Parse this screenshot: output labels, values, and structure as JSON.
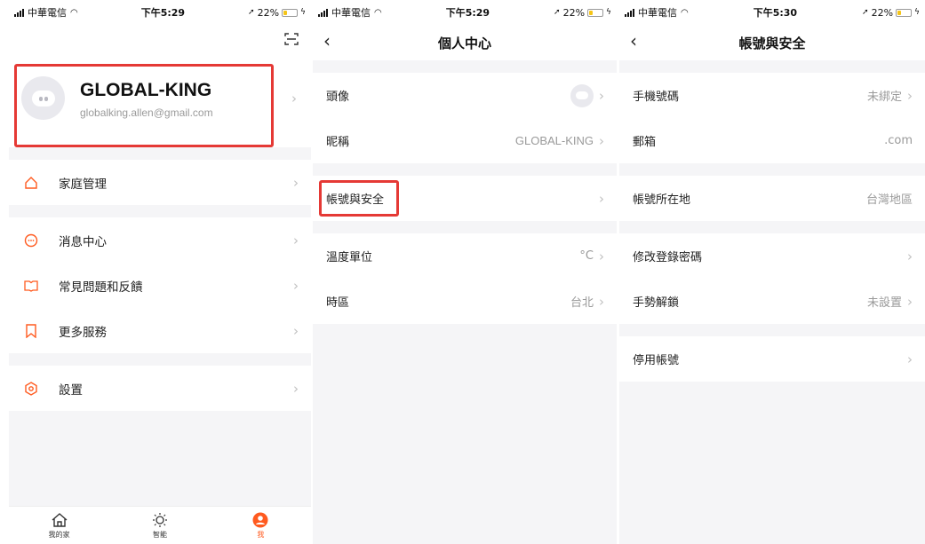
{
  "status": {
    "s1": {
      "carrier": "中華電信",
      "time": "下午5:29",
      "battery": "22%"
    },
    "s2": {
      "carrier": "中華電信",
      "time": "下午5:29",
      "battery": "22%"
    },
    "s3": {
      "carrier": "中華電信",
      "time": "下午5:30",
      "battery": "22%"
    }
  },
  "colors": {
    "accent": "#ff5a1f",
    "highlight_box": "#e53935"
  },
  "screen1": {
    "profile": {
      "name": "GLOBAL-KING",
      "email": "globalking.allen@gmail.com"
    },
    "menu": [
      {
        "label": "家庭管理",
        "icon": "home-icon"
      },
      {
        "label": "消息中心",
        "icon": "message-icon"
      },
      {
        "label": "常見問題和反饋",
        "icon": "book-icon"
      },
      {
        "label": "更多服務",
        "icon": "bookmark-icon"
      },
      {
        "label": "設置",
        "icon": "settings-icon"
      }
    ],
    "tabs": [
      {
        "label": "我的家",
        "icon": "house-tab-icon"
      },
      {
        "label": "智能",
        "icon": "sun-icon"
      },
      {
        "label": "我",
        "icon": "user-icon",
        "active": true
      }
    ]
  },
  "screen2": {
    "title": "個人中心",
    "rows": {
      "avatar": {
        "label": "頭像"
      },
      "nickname": {
        "label": "昵稱",
        "value": "GLOBAL-KING"
      },
      "account_security": {
        "label": "帳號與安全"
      },
      "temperature": {
        "label": "溫度單位",
        "value": "°C"
      },
      "timezone": {
        "label": "時區",
        "value": "台北"
      }
    }
  },
  "screen3": {
    "title": "帳號與安全",
    "rows": {
      "phone": {
        "label": "手機號碼",
        "value": "未綁定"
      },
      "email": {
        "label": "郵箱",
        "value": ".com"
      },
      "region": {
        "label": "帳號所在地",
        "value": "台灣地區"
      },
      "change_password": {
        "label": "修改登錄密碼"
      },
      "gesture": {
        "label": "手勢解鎖",
        "value": "未設置"
      },
      "deactivate": {
        "label": "停用帳號"
      }
    }
  },
  "icons": {
    "chevron": "›",
    "back": "‹"
  }
}
